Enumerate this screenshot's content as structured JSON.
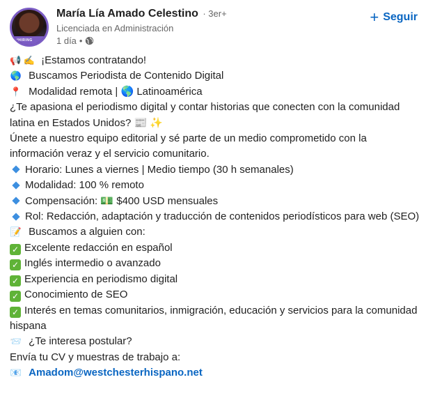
{
  "author": {
    "name": "María Lía Amado Celestino",
    "degree": "· 3er+",
    "headline": "Licenciada en Administración",
    "time": "1 día",
    "visibility_separator": "•",
    "avatar_badge": "#HIRING"
  },
  "follow_button": {
    "icon": "+",
    "label": "Seguir"
  },
  "post": {
    "lines": [
      {
        "icon": "📢 ✍️",
        "text": "¡Estamos contratando!"
      },
      {
        "icon": "🌎",
        "text": "Buscamos Periodista de Contenido Digital"
      },
      {
        "icon": "📍",
        "text": "Modalidad remota | 🌎 Latinoamérica"
      }
    ],
    "intro_1": "¿Te apasiona el periodismo digital y contar historias que conecten con la comunidad latina en Estados Unidos? 📰 ✨",
    "intro_2": "Únete a nuestro equipo editorial y sé parte de un medio comprometido con la información veraz y el servicio comunitario.",
    "details": [
      "Horario: Lunes a viernes | Medio tiempo (30 h semanales)",
      "Modalidad: 100 % remoto",
      "Compensación: 💵 $400 USD mensuales",
      "Rol: Redacción, adaptación y traducción de contenidos periodísticos para web (SEO)"
    ],
    "looking_for_icon": "📝",
    "looking_for": "Buscamos a alguien con:",
    "requirements": [
      "Excelente redacción en español",
      "Inglés intermedio o avanzado",
      "Experiencia en periodismo digital",
      "Conocimiento de SEO",
      "Interés en temas comunitarios, inmigración, educación y servicios para la comunidad hispana"
    ],
    "apply_icon": "📨",
    "apply_question": "¿Te interesa postular?",
    "send_cv": "Envía tu CV y muestras de trabajo a:",
    "email_icon": "📧",
    "email": "Amadom@westchesterhispano.net"
  }
}
